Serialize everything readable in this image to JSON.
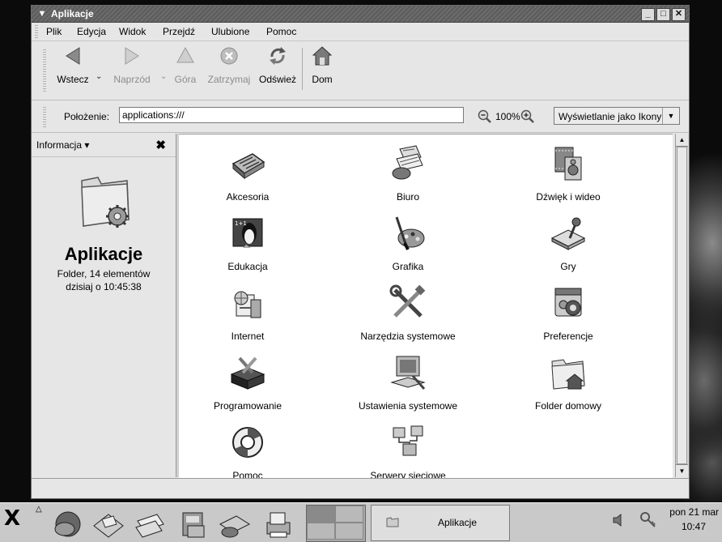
{
  "window": {
    "title": "Aplikacje"
  },
  "menu": [
    "Plik",
    "Edycja",
    "Widok",
    "Przejdź",
    "Ulubione",
    "Pomoc"
  ],
  "toolbar": {
    "back": "Wstecz",
    "forward": "Naprzód",
    "up": "Góra",
    "stop": "Zatrzymaj",
    "reload": "Odśwież",
    "home": "Dom"
  },
  "location": {
    "label": "Położenie:",
    "value": "applications:///"
  },
  "zoom": {
    "level": "100%"
  },
  "view_mode": {
    "selected": "Wyświetlanie jako Ikony"
  },
  "sidepane": {
    "selector": "Informacja",
    "title": "Aplikacje",
    "count": "Folder, 14 elementów",
    "date": "dzisiaj o 10:45:38"
  },
  "apps": [
    {
      "label": "Akcesoria",
      "icon": "calculator-icon"
    },
    {
      "label": "Biuro",
      "icon": "office-icon"
    },
    {
      "label": "Dźwięk i wideo",
      "icon": "multimedia-icon"
    },
    {
      "label": "Edukacja",
      "icon": "education-icon"
    },
    {
      "label": "Grafika",
      "icon": "graphics-palette-icon"
    },
    {
      "label": "Gry",
      "icon": "games-joystick-icon"
    },
    {
      "label": "Internet",
      "icon": "internet-icon"
    },
    {
      "label": "Narzędzia systemowe",
      "icon": "system-tools-icon"
    },
    {
      "label": "Preferencje",
      "icon": "preferences-icon"
    },
    {
      "label": "Programowanie",
      "icon": "programming-toolbox-icon"
    },
    {
      "label": "Ustawienia systemowe",
      "icon": "system-settings-icon"
    },
    {
      "label": "Folder domowy",
      "icon": "home-folder-icon"
    },
    {
      "label": "Pomoc",
      "icon": "help-lifebuoy-icon"
    },
    {
      "label": "Serwery sieciowe",
      "icon": "network-servers-icon"
    }
  ],
  "taskbar": {
    "task": "Aplikacje",
    "clock_day": "pon 21 mar",
    "clock_time": "10:47"
  }
}
